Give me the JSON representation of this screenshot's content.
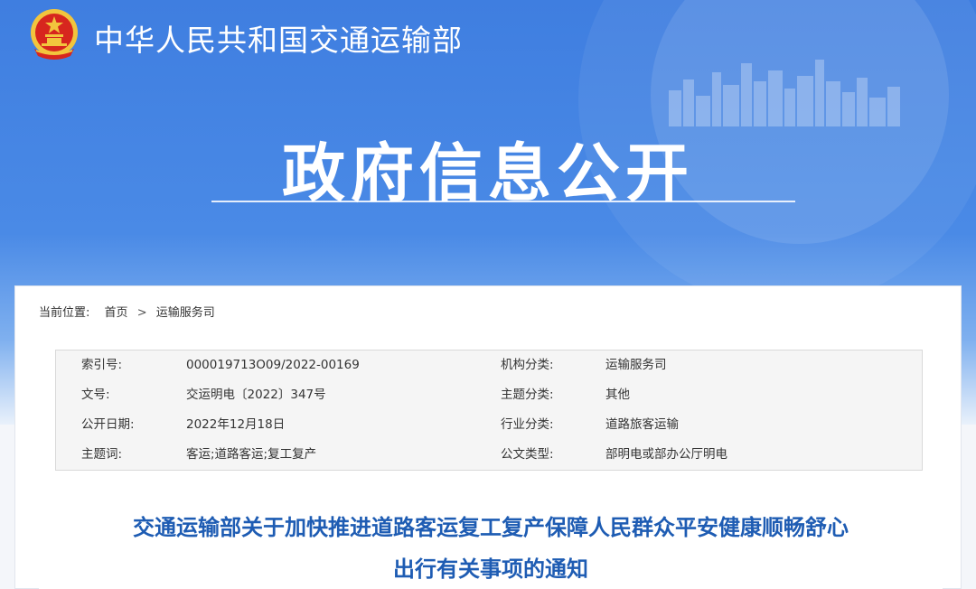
{
  "header": {
    "ministry_name": "中华人民共和国交通运输部",
    "banner_title": "政府信息公开"
  },
  "breadcrumb": {
    "label": "当前位置:",
    "items": [
      "首页",
      "运输服务司"
    ],
    "separator": ">"
  },
  "meta": {
    "rows": [
      {
        "left_key": "索引号:",
        "left_value": "000019713O09/2022-00169",
        "right_key": "机构分类:",
        "right_value": "运输服务司"
      },
      {
        "left_key": "文号:",
        "left_value": "交运明电〔2022〕347号",
        "right_key": "主题分类:",
        "right_value": "其他"
      },
      {
        "left_key": "公开日期:",
        "left_value": "2022年12月18日",
        "right_key": "行业分类:",
        "right_value": "道路旅客运输"
      },
      {
        "left_key": "主题词:",
        "left_value": "客运;道路客运;复工复产",
        "right_key": "公文类型:",
        "right_value": "部明电或部办公厅明电"
      }
    ]
  },
  "document": {
    "title_line1": "交通运输部关于加快推进道路客运复工复产保障人民群众平安健康顺畅舒心",
    "title_line2": "出行有关事项的通知"
  },
  "colors": {
    "banner_blue": "#4a8ae6",
    "title_blue": "#1e5cb3",
    "emblem_red": "#d7261e",
    "emblem_gold": "#f2c53d"
  },
  "icons": {
    "emblem": "national-emblem-icon"
  }
}
